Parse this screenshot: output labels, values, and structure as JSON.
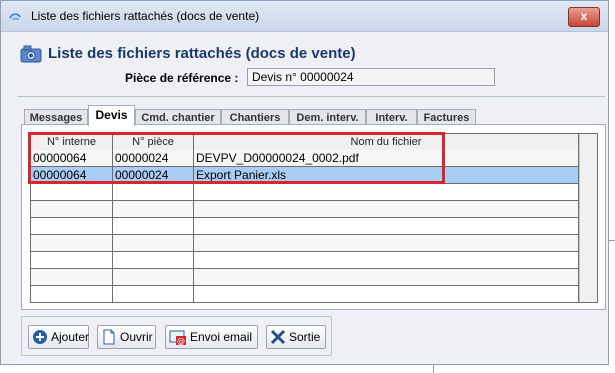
{
  "window": {
    "title": "Liste des fichiers rattachés (docs de vente)",
    "close_glyph": "x"
  },
  "header": {
    "title": "Liste des fichiers rattachés (docs de vente)",
    "ref_label": "Pièce de référence :",
    "ref_value": "Devis n° 00000024"
  },
  "tabs": [
    {
      "label": "Messages",
      "active": false
    },
    {
      "label": "Devis",
      "active": true
    },
    {
      "label": "Cmd. chantier",
      "active": false
    },
    {
      "label": "Chantiers",
      "active": false
    },
    {
      "label": "Dem. interv.",
      "active": false
    },
    {
      "label": "Interv.",
      "active": false
    },
    {
      "label": "Factures",
      "active": false
    }
  ],
  "table": {
    "columns": [
      "N° interne",
      "N° pièce",
      "Nom du fichier"
    ],
    "rows": [
      [
        "00000064",
        "00000024",
        "DEVPV_D00000024_0002.pdf"
      ],
      [
        "00000064",
        "00000024",
        "Export Panier.xls"
      ]
    ],
    "selected_row": 1
  },
  "buttons": {
    "add": "Ajouter",
    "open": "Ouvrir",
    "email": "Envoi email",
    "exit": "Sortie"
  },
  "colors": {
    "selection": "#a9cdf2",
    "highlight": "#d8262e",
    "title_blue": "#1a3a6a"
  }
}
